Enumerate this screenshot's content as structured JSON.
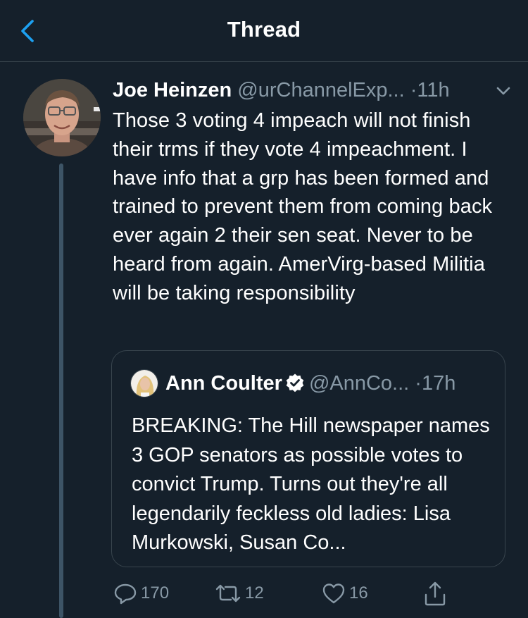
{
  "header": {
    "title": "Thread",
    "back_icon": "chevron-left-icon"
  },
  "tweet": {
    "author_name": "Joe Heinzen",
    "handle": "@urChannelExp...",
    "separator": "·",
    "time": "11h",
    "text": "Those 3 voting 4 impeach will not finish their trms if they vote 4 impeachment. I have info that a grp has been formed and trained to prevent them from coming back ever again 2 their sen seat. Never to be heard from again. AmerVirg-based Militia will be taking responsibility",
    "quote": {
      "author_name": "Ann Coulter",
      "handle": "@AnnCo...",
      "separator": "·",
      "time": "17h",
      "text": "BREAKING: The Hill newspaper names 3 GOP senators as possible votes to convict Trump.  Turns out they're all legendarily feckless old ladies: Lisa Murkowski, Susan Co..."
    },
    "actions": {
      "replies": "170",
      "retweets": "12",
      "likes": "16"
    }
  },
  "colors": {
    "background": "#15202b",
    "border": "#38444d",
    "accent": "#1da1f2",
    "secondary_text": "#8899a6",
    "thread_line": "#3d5466"
  }
}
